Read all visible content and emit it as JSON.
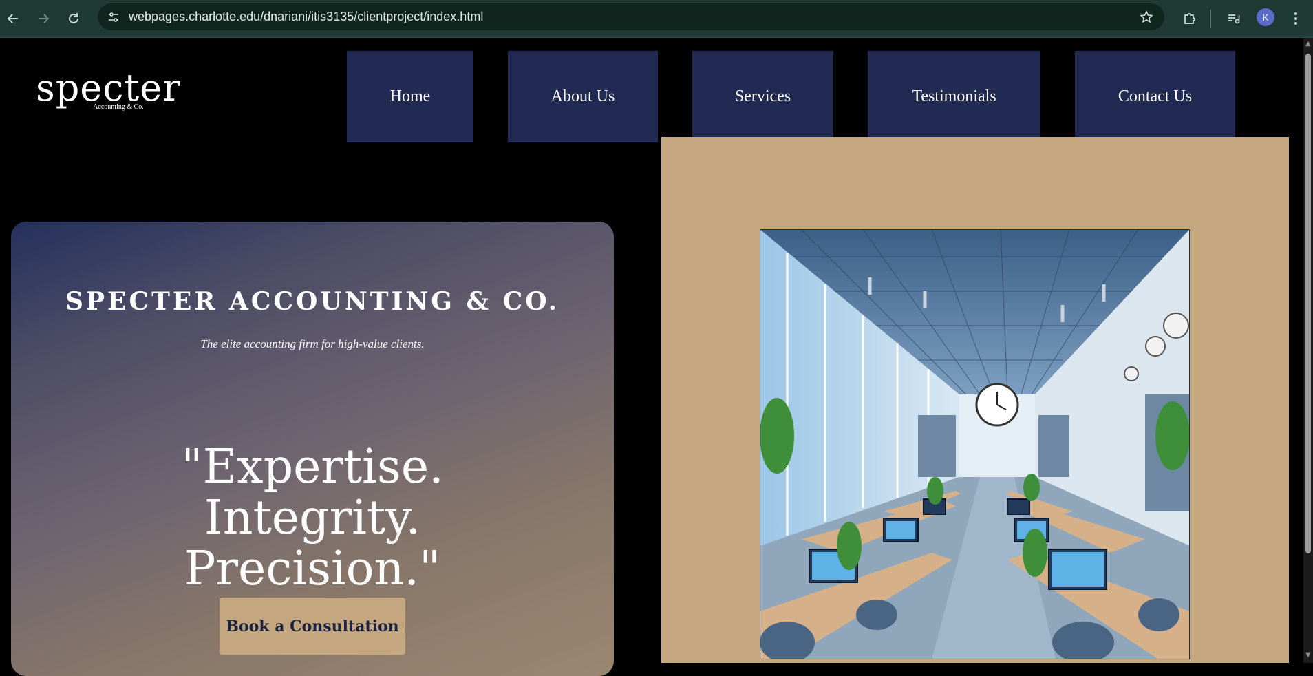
{
  "browser": {
    "url": "webpages.charlotte.edu/dnariani/itis3135/clientproject/index.html",
    "profile_initial": "K",
    "icons": {
      "back": "arrow-left-icon",
      "forward": "arrow-right-icon",
      "reload": "reload-icon",
      "site_info": "tune-icon",
      "bookmark": "star-icon",
      "extensions": "puzzle-icon",
      "media": "media-queue-icon",
      "menu": "kebab-menu-icon"
    }
  },
  "site": {
    "logo": {
      "word": "specter",
      "tagline": "Accounting & Co."
    },
    "nav": [
      {
        "label": "Home"
      },
      {
        "label": "About Us"
      },
      {
        "label": "Services"
      },
      {
        "label": "Testimonials"
      },
      {
        "label": "Contact Us"
      }
    ],
    "hero": {
      "title": "SPECTER ACCOUNTING & CO.",
      "subtitle": "The elite accounting firm for high-value clients.",
      "quote": "\"Expertise. Integrity. Precision.\"",
      "cta_label": "Book a Consultation"
    }
  },
  "colors": {
    "nav_bg": "#202a52",
    "accent_tan": "#c4a67f",
    "cta_text": "#1c2340",
    "chrome_bg": "#1f3a34"
  }
}
